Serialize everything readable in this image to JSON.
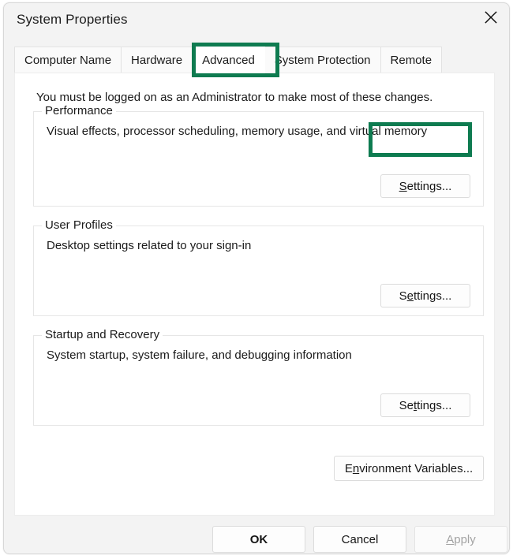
{
  "window": {
    "title": "System Properties",
    "close_icon": "close-icon"
  },
  "tabs": [
    {
      "label": "Computer Name",
      "active": false
    },
    {
      "label": "Hardware",
      "active": false
    },
    {
      "label": "Advanced",
      "active": true
    },
    {
      "label": "System Protection",
      "active": false
    },
    {
      "label": "Remote",
      "active": false
    }
  ],
  "highlights": {
    "color": "#0e7b50",
    "targets": [
      "tab-advanced",
      "performance-settings-button"
    ]
  },
  "page": {
    "admin_note": "You must be logged on as an Administrator to make most of these changes.",
    "groups": [
      {
        "title": "Performance",
        "description": "Visual effects, processor scheduling, memory usage, and virtual memory",
        "button": {
          "label": "Settings...",
          "mnemonic": "S",
          "highlighted": true
        }
      },
      {
        "title": "User Profiles",
        "description": "Desktop settings related to your sign-in",
        "button": {
          "label": "Settings...",
          "mnemonic": "e",
          "highlighted": false
        }
      },
      {
        "title": "Startup and Recovery",
        "description": "System startup, system failure, and debugging information",
        "button": {
          "label": "Settings...",
          "mnemonic": "t",
          "highlighted": false
        }
      }
    ],
    "environment_variables_button": {
      "label": "Environment Variables...",
      "mnemonic": "n"
    }
  },
  "footer": {
    "ok_label": "OK",
    "cancel_label": "Cancel",
    "apply_label": "Apply",
    "apply_mnemonic": "A",
    "apply_disabled": true
  }
}
